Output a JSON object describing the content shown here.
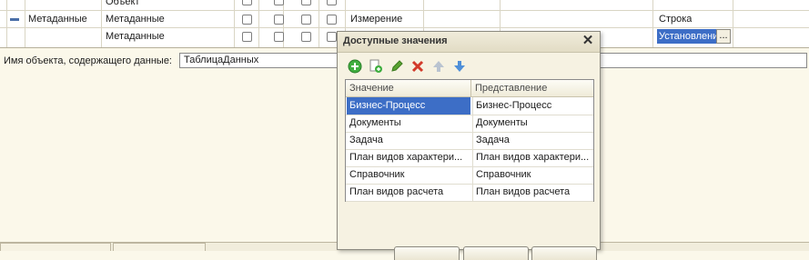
{
  "grid": {
    "rows": [
      {
        "col2": "Объект"
      },
      {
        "col1": "Метаданные",
        "col2": "Метаданные",
        "col7": "Измерение",
        "col10": "Строка"
      },
      {
        "col2": "Метаданные",
        "col10": "Установлени",
        "ellipsis": "..."
      }
    ]
  },
  "object_field": {
    "label": "Имя объекта, содержащего данные:",
    "value": "ТаблицаДанных"
  },
  "dialog": {
    "title": "Доступные значения",
    "close": "✕",
    "columns": [
      "Значение",
      "Представление"
    ],
    "rows": [
      {
        "value": "Бизнес-Процесс",
        "repr": "Бизнес-Процесс"
      },
      {
        "value": "Документы",
        "repr": "Документы"
      },
      {
        "value": "Задача",
        "repr": "Задача"
      },
      {
        "value": "План видов характери...",
        "repr": "План видов характери..."
      },
      {
        "value": "Справочник",
        "repr": "Справочник"
      },
      {
        "value": "План видов расчета",
        "repr": "План видов расчета"
      }
    ],
    "selected_row": 0,
    "toolbar": [
      "add-icon",
      "copy-icon",
      "edit-icon",
      "delete-icon",
      "move-up-icon",
      "move-down-icon"
    ]
  },
  "colors": {
    "selection": "#3d6ec6",
    "background": "#fbf8ea"
  }
}
